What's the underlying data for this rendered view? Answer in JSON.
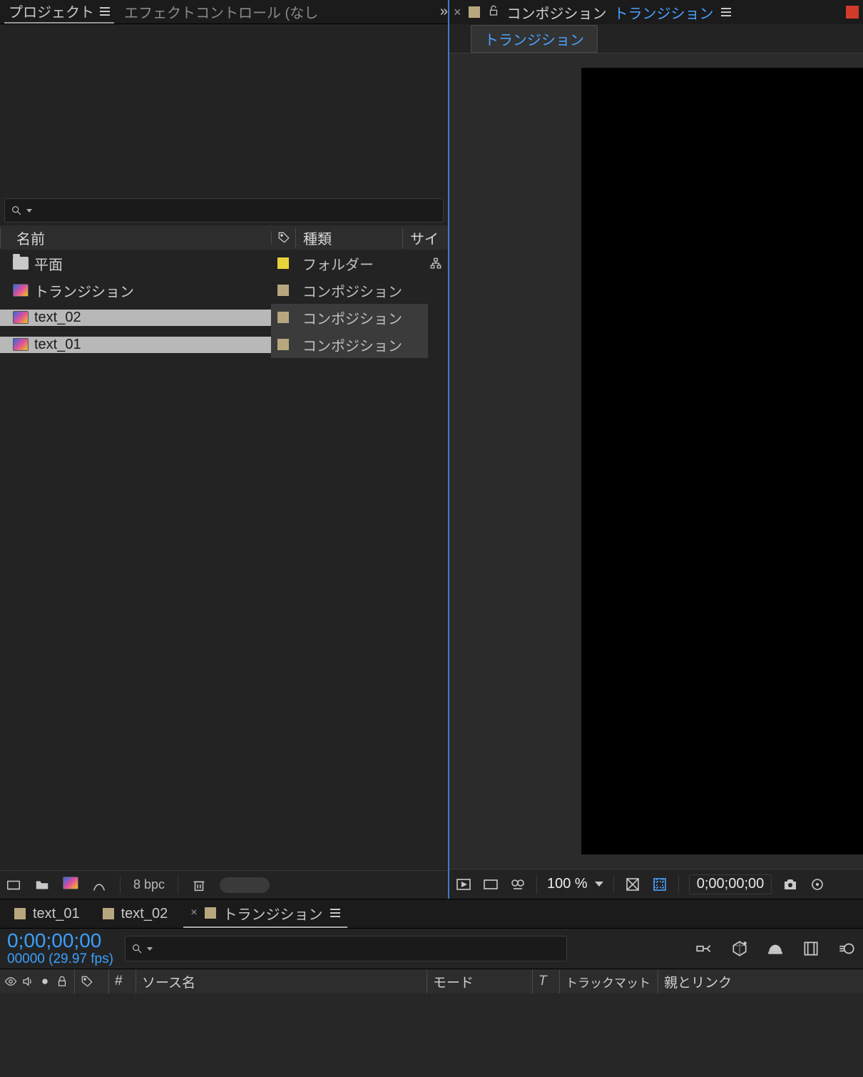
{
  "project_panel": {
    "tab_project": "プロジェクト",
    "tab_effects": "エフェクトコントロール (なし",
    "search_placeholder": "",
    "columns": {
      "name": "名前",
      "type": "種類",
      "size": "サイ"
    },
    "rows": [
      {
        "name": "平面",
        "type": "フォルダー",
        "icon": "folder",
        "tag_color": "#e8d23a",
        "selected": false,
        "flow": true
      },
      {
        "name": "トランジション",
        "type": "コンポジション",
        "icon": "comp",
        "tag_color": "#b8a77e",
        "selected": false,
        "flow": false
      },
      {
        "name": "text_02",
        "type": "コンポジション",
        "icon": "comp",
        "tag_color": "#b8a77e",
        "selected": true,
        "flow": false
      },
      {
        "name": "text_01",
        "type": "コンポジション",
        "icon": "comp",
        "tag_color": "#b8a77e",
        "selected": true,
        "flow": false
      }
    ],
    "bpc": "8 bpc"
  },
  "viewer_panel": {
    "comp_label_prefix": "コンポジション",
    "comp_name": "トランジション",
    "breadcrumb": "トランジション",
    "zoom": "100 %",
    "time": "0;00;00;00"
  },
  "timeline_panel": {
    "tabs": [
      {
        "label": "text_01",
        "active": false,
        "closeable": false
      },
      {
        "label": "text_02",
        "active": false,
        "closeable": false
      },
      {
        "label": "トランジション",
        "active": true,
        "closeable": true
      }
    ],
    "timecode": "0;00;00;00",
    "timecode_sub": "00000 (29.97 fps)",
    "columns": {
      "hash": "#",
      "source": "ソース名",
      "mode": "モード",
      "t": "T",
      "trackmatte": "トラックマット",
      "parent": "親とリンク"
    }
  }
}
